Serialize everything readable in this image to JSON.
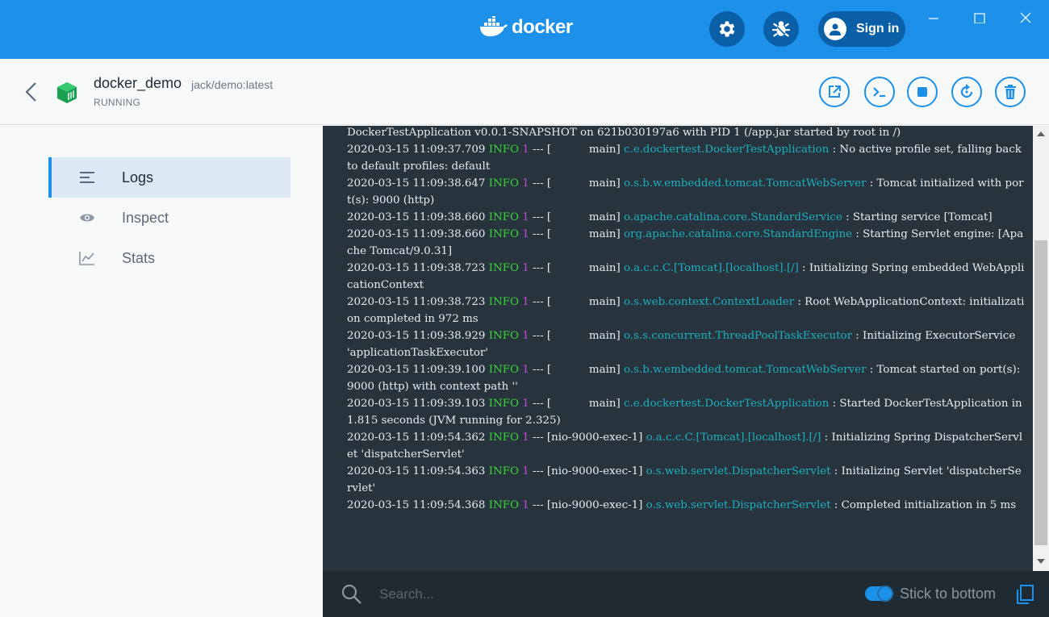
{
  "titlebar": {
    "app_name": "docker",
    "signin_label": "Sign in",
    "icons": [
      "docker-whale-icon",
      "gear-icon",
      "bug-icon",
      "user-icon",
      "minimize-icon",
      "maximize-icon",
      "close-icon"
    ],
    "accent_color": "#1d91ea"
  },
  "container": {
    "name": "docker_demo",
    "image": "jack/demo:latest",
    "status": "RUNNING",
    "actions": [
      "open-in-browser-icon",
      "cli-icon",
      "stop-icon",
      "restart-icon",
      "delete-icon"
    ]
  },
  "sidebar": {
    "items": [
      {
        "label": "Logs",
        "icon": "logs-icon",
        "active": true
      },
      {
        "label": "Inspect",
        "icon": "eye-icon",
        "active": false
      },
      {
        "label": "Stats",
        "icon": "chart-icon",
        "active": false
      }
    ]
  },
  "logs": {
    "first_line": "DockerTestApplication v0.0.1-SNAPSHOT on 621b030197a6 with PID 1 (/app.jar started by root in /)",
    "entries": [
      {
        "ts": "2020-03-15 11:09:37.709",
        "level": "INFO",
        "pid": "1",
        "thread": "[           main]",
        "cls": "c.e.dockertest.DockerTestApplication",
        "msg": ": No active profile set, falling back to default profiles: default"
      },
      {
        "ts": "2020-03-15 11:09:38.647",
        "level": "INFO",
        "pid": "1",
        "thread": "[           main]",
        "cls": "o.s.b.w.embedded.tomcat.TomcatWebServer",
        "msg": ": Tomcat initialized with port(s): 9000 (http)"
      },
      {
        "ts": "2020-03-15 11:09:38.660",
        "level": "INFO",
        "pid": "1",
        "thread": "[           main]",
        "cls": "o.apache.catalina.core.StandardService",
        "msg": ": Starting service [Tomcat]"
      },
      {
        "ts": "2020-03-15 11:09:38.660",
        "level": "INFO",
        "pid": "1",
        "thread": "[           main]",
        "cls": "org.apache.catalina.core.StandardEngine",
        "msg": ": Starting Servlet engine: [Apache Tomcat/9.0.31]"
      },
      {
        "ts": "2020-03-15 11:09:38.723",
        "level": "INFO",
        "pid": "1",
        "thread": "[           main]",
        "cls": "o.a.c.c.C.[Tomcat].[localhost].[/]",
        "msg": ": Initializing Spring embedded WebApplicationContext"
      },
      {
        "ts": "2020-03-15 11:09:38.723",
        "level": "INFO",
        "pid": "1",
        "thread": "[           main]",
        "cls": "o.s.web.context.ContextLoader",
        "msg": ": Root WebApplicationContext: initialization completed in 972 ms"
      },
      {
        "ts": "2020-03-15 11:09:38.929",
        "level": "INFO",
        "pid": "1",
        "thread": "[           main]",
        "cls": "o.s.s.concurrent.ThreadPoolTaskExecutor",
        "msg": ": Initializing ExecutorService 'applicationTaskExecutor'"
      },
      {
        "ts": "2020-03-15 11:09:39.100",
        "level": "INFO",
        "pid": "1",
        "thread": "[           main]",
        "cls": "o.s.b.w.embedded.tomcat.TomcatWebServer",
        "msg": ": Tomcat started on port(s): 9000 (http) with context path ''"
      },
      {
        "ts": "2020-03-15 11:09:39.103",
        "level": "INFO",
        "pid": "1",
        "thread": "[           main]",
        "cls": "c.e.dockertest.DockerTestApplication",
        "msg": ": Started DockerTestApplication in 1.815 seconds (JVM running for 2.325)"
      },
      {
        "ts": "2020-03-15 11:09:54.362",
        "level": "INFO",
        "pid": "1",
        "thread": "[nio-9000-exec-1]",
        "cls": "o.a.c.c.C.[Tomcat].[localhost].[/]",
        "msg": ": Initializing Spring DispatcherServlet 'dispatcherServlet'"
      },
      {
        "ts": "2020-03-15 11:09:54.363",
        "level": "INFO",
        "pid": "1",
        "thread": "[nio-9000-exec-1]",
        "cls": "o.s.web.servlet.DispatcherServlet",
        "msg": ": Initializing Servlet 'dispatcherServlet'"
      },
      {
        "ts": "2020-03-15 11:09:54.368",
        "level": "INFO",
        "pid": "1",
        "thread": "[nio-9000-exec-1]",
        "cls": "o.s.web.servlet.DispatcherServlet",
        "msg": ": Completed initialization in 5 ms"
      }
    ]
  },
  "footer": {
    "search_placeholder": "Search...",
    "stick_label": "Stick to bottom",
    "stick_enabled": true
  }
}
